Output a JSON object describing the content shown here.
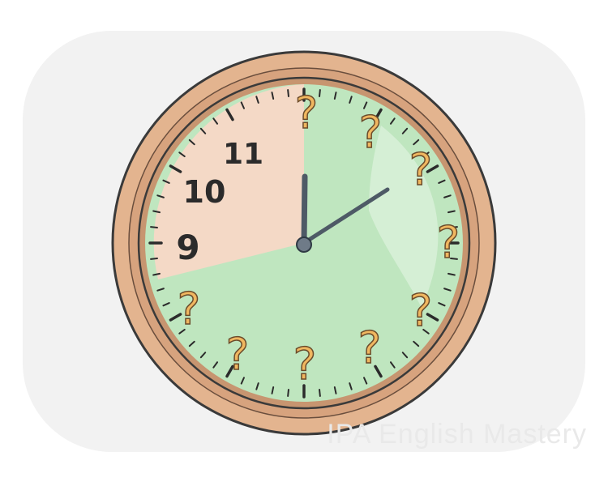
{
  "illustration": {
    "subject": "wall clock",
    "numerals": [
      "9",
      "10",
      "11"
    ],
    "unknown_mark": "?",
    "unknown_positions": [
      12,
      1,
      2,
      3,
      4,
      5,
      6,
      7,
      8
    ],
    "time_shown": {
      "hour": 12,
      "minute": 10
    },
    "colors": {
      "rim_outer": "#e3b48f",
      "rim_inner": "#c79570",
      "face_known": "#f4d9c6",
      "face_unknown": "#bfe6bf",
      "question_mark": "#f0b760",
      "hands": "#4e5a66",
      "numerals": "#2b2b2b",
      "backdrop": "#f2f2f2"
    }
  },
  "watermark": {
    "text": "IPA English Mastery"
  }
}
